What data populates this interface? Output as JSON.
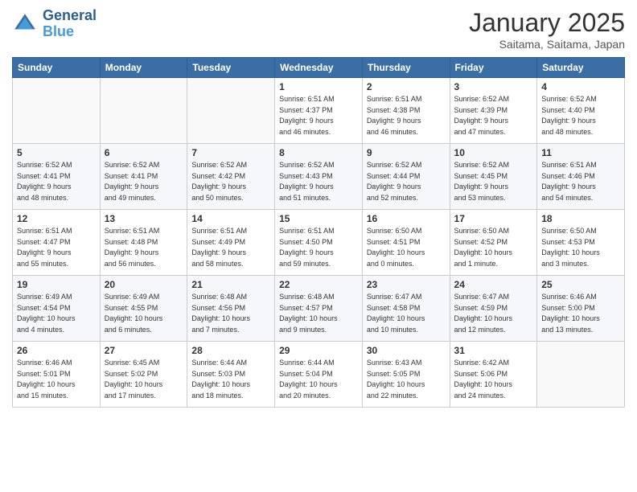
{
  "header": {
    "logo_line1": "General",
    "logo_line2": "Blue",
    "month_title": "January 2025",
    "location": "Saitama, Saitama, Japan"
  },
  "weekdays": [
    "Sunday",
    "Monday",
    "Tuesday",
    "Wednesday",
    "Thursday",
    "Friday",
    "Saturday"
  ],
  "weeks": [
    [
      {
        "day": "",
        "info": ""
      },
      {
        "day": "",
        "info": ""
      },
      {
        "day": "",
        "info": ""
      },
      {
        "day": "1",
        "info": "Sunrise: 6:51 AM\nSunset: 4:37 PM\nDaylight: 9 hours\nand 46 minutes."
      },
      {
        "day": "2",
        "info": "Sunrise: 6:51 AM\nSunset: 4:38 PM\nDaylight: 9 hours\nand 46 minutes."
      },
      {
        "day": "3",
        "info": "Sunrise: 6:52 AM\nSunset: 4:39 PM\nDaylight: 9 hours\nand 47 minutes."
      },
      {
        "day": "4",
        "info": "Sunrise: 6:52 AM\nSunset: 4:40 PM\nDaylight: 9 hours\nand 48 minutes."
      }
    ],
    [
      {
        "day": "5",
        "info": "Sunrise: 6:52 AM\nSunset: 4:41 PM\nDaylight: 9 hours\nand 48 minutes."
      },
      {
        "day": "6",
        "info": "Sunrise: 6:52 AM\nSunset: 4:41 PM\nDaylight: 9 hours\nand 49 minutes."
      },
      {
        "day": "7",
        "info": "Sunrise: 6:52 AM\nSunset: 4:42 PM\nDaylight: 9 hours\nand 50 minutes."
      },
      {
        "day": "8",
        "info": "Sunrise: 6:52 AM\nSunset: 4:43 PM\nDaylight: 9 hours\nand 51 minutes."
      },
      {
        "day": "9",
        "info": "Sunrise: 6:52 AM\nSunset: 4:44 PM\nDaylight: 9 hours\nand 52 minutes."
      },
      {
        "day": "10",
        "info": "Sunrise: 6:52 AM\nSunset: 4:45 PM\nDaylight: 9 hours\nand 53 minutes."
      },
      {
        "day": "11",
        "info": "Sunrise: 6:51 AM\nSunset: 4:46 PM\nDaylight: 9 hours\nand 54 minutes."
      }
    ],
    [
      {
        "day": "12",
        "info": "Sunrise: 6:51 AM\nSunset: 4:47 PM\nDaylight: 9 hours\nand 55 minutes."
      },
      {
        "day": "13",
        "info": "Sunrise: 6:51 AM\nSunset: 4:48 PM\nDaylight: 9 hours\nand 56 minutes."
      },
      {
        "day": "14",
        "info": "Sunrise: 6:51 AM\nSunset: 4:49 PM\nDaylight: 9 hours\nand 58 minutes."
      },
      {
        "day": "15",
        "info": "Sunrise: 6:51 AM\nSunset: 4:50 PM\nDaylight: 9 hours\nand 59 minutes."
      },
      {
        "day": "16",
        "info": "Sunrise: 6:50 AM\nSunset: 4:51 PM\nDaylight: 10 hours\nand 0 minutes."
      },
      {
        "day": "17",
        "info": "Sunrise: 6:50 AM\nSunset: 4:52 PM\nDaylight: 10 hours\nand 1 minute."
      },
      {
        "day": "18",
        "info": "Sunrise: 6:50 AM\nSunset: 4:53 PM\nDaylight: 10 hours\nand 3 minutes."
      }
    ],
    [
      {
        "day": "19",
        "info": "Sunrise: 6:49 AM\nSunset: 4:54 PM\nDaylight: 10 hours\nand 4 minutes."
      },
      {
        "day": "20",
        "info": "Sunrise: 6:49 AM\nSunset: 4:55 PM\nDaylight: 10 hours\nand 6 minutes."
      },
      {
        "day": "21",
        "info": "Sunrise: 6:48 AM\nSunset: 4:56 PM\nDaylight: 10 hours\nand 7 minutes."
      },
      {
        "day": "22",
        "info": "Sunrise: 6:48 AM\nSunset: 4:57 PM\nDaylight: 10 hours\nand 9 minutes."
      },
      {
        "day": "23",
        "info": "Sunrise: 6:47 AM\nSunset: 4:58 PM\nDaylight: 10 hours\nand 10 minutes."
      },
      {
        "day": "24",
        "info": "Sunrise: 6:47 AM\nSunset: 4:59 PM\nDaylight: 10 hours\nand 12 minutes."
      },
      {
        "day": "25",
        "info": "Sunrise: 6:46 AM\nSunset: 5:00 PM\nDaylight: 10 hours\nand 13 minutes."
      }
    ],
    [
      {
        "day": "26",
        "info": "Sunrise: 6:46 AM\nSunset: 5:01 PM\nDaylight: 10 hours\nand 15 minutes."
      },
      {
        "day": "27",
        "info": "Sunrise: 6:45 AM\nSunset: 5:02 PM\nDaylight: 10 hours\nand 17 minutes."
      },
      {
        "day": "28",
        "info": "Sunrise: 6:44 AM\nSunset: 5:03 PM\nDaylight: 10 hours\nand 18 minutes."
      },
      {
        "day": "29",
        "info": "Sunrise: 6:44 AM\nSunset: 5:04 PM\nDaylight: 10 hours\nand 20 minutes."
      },
      {
        "day": "30",
        "info": "Sunrise: 6:43 AM\nSunset: 5:05 PM\nDaylight: 10 hours\nand 22 minutes."
      },
      {
        "day": "31",
        "info": "Sunrise: 6:42 AM\nSunset: 5:06 PM\nDaylight: 10 hours\nand 24 minutes."
      },
      {
        "day": "",
        "info": ""
      }
    ]
  ]
}
